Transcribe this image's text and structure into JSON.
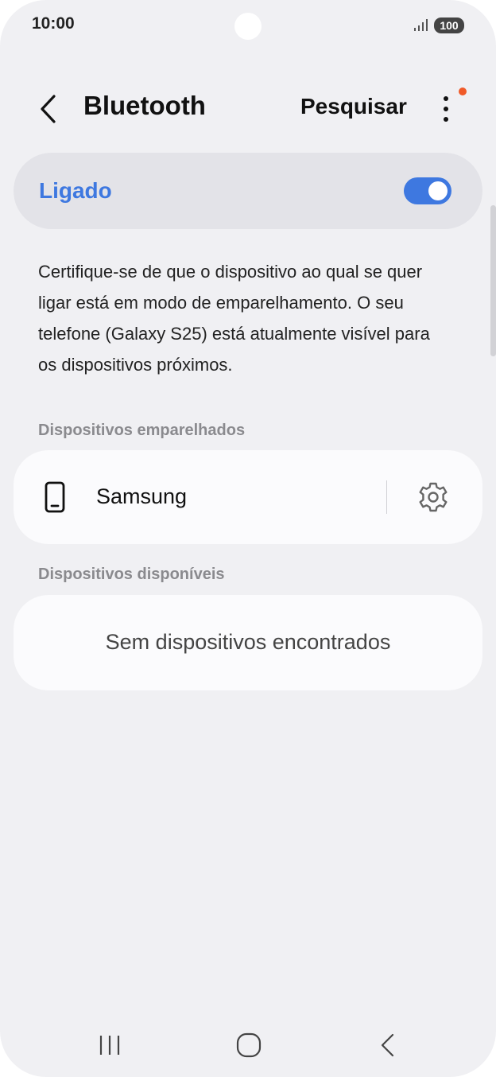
{
  "status_bar": {
    "time": "10:00",
    "battery": "100",
    "icons": [
      "signal-icon",
      "battery-icon"
    ]
  },
  "header": {
    "title": "Bluetooth",
    "search_label": "Pesquisar",
    "back_icon": "chevron-left-icon",
    "more_icon": "more-vertical-icon"
  },
  "toggle": {
    "label": "Ligado",
    "state": "on"
  },
  "info_text": "Certifique-se de que o dispositivo ao qual se quer ligar está em modo de emparelhamento. O seu telefone (Galaxy S25) está atualmente visível para os dispositivos próximos.",
  "paired": {
    "section_label": "Dispositivos emparelhados",
    "devices": [
      {
        "name": "Samsung",
        "icon": "phone-icon",
        "settings_icon": "gear-icon"
      }
    ]
  },
  "available": {
    "section_label": "Dispositivos disponíveis",
    "empty_message": "Sem dispositivos encontrados"
  },
  "nav_bar": {
    "icons": [
      "recent-apps-icon",
      "home-icon",
      "back-icon"
    ]
  },
  "colors": {
    "accent": "#3e78e0",
    "background": "#f0f0f3",
    "card": "#fbfbfd",
    "notification_dot": "#f05a28"
  }
}
